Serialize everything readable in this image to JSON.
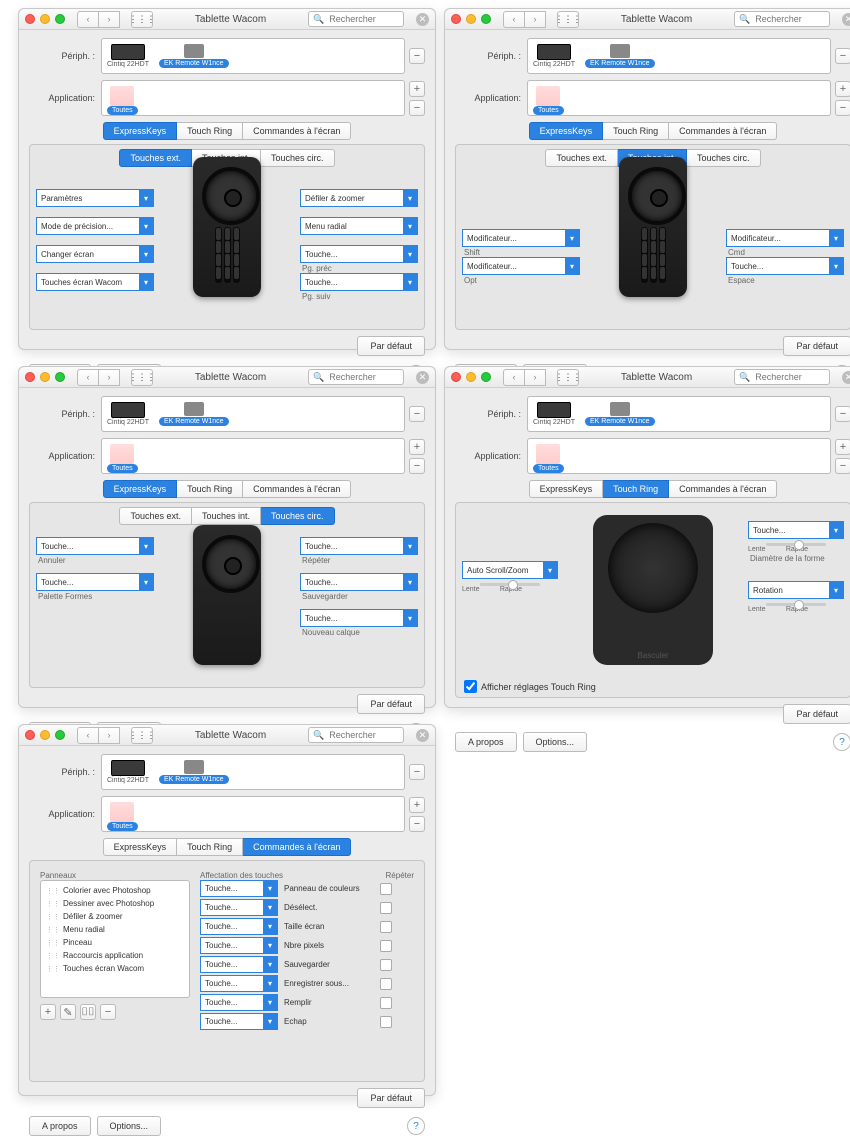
{
  "common": {
    "window_title": "Tablette Wacom",
    "search_placeholder": "Rechercher",
    "periph_label": "Périph. :",
    "app_label": "Application:",
    "device1": "Cintiq 22HDT",
    "device2": "EK Remote W1nce",
    "app_all": "Toutes",
    "tabs_main": {
      "express": "ExpressKeys",
      "ring": "Touch Ring",
      "screen": "Commandes à l'écran"
    },
    "tabs_sub": {
      "ext": "Touches ext.",
      "int": "Touches int.",
      "circ": "Touches circ."
    },
    "default_btn": "Par défaut",
    "about_btn": "A propos",
    "options_btn": "Options...",
    "add": "+",
    "remove": "−"
  },
  "p1": {
    "left": {
      "a": "Paramètres",
      "b": "Mode de précision...",
      "c": "Changer écran",
      "d": "Touches écran Wacom"
    },
    "right": {
      "a": "Défiler & zoomer",
      "b": "Menu radial",
      "c": "Touche...",
      "c_sub": "Pg. préc",
      "d": "Touche...",
      "d_sub": "Pg. suiv"
    }
  },
  "p2": {
    "left": {
      "a": "Modificateur...",
      "a_sub": "Shift",
      "b": "Modificateur...",
      "b_sub": "Opt"
    },
    "right": {
      "a": "Modificateur...",
      "a_sub": "Cmd",
      "b": "Touche...",
      "b_sub": "Espace"
    }
  },
  "p3": {
    "left": {
      "a": "Touche...",
      "a_sub": "Annuler",
      "b": "Touche...",
      "b_sub": "Palette Formes"
    },
    "right": {
      "a": "Touche...",
      "a_sub": "Répéter",
      "b": "Touche...",
      "b_sub": "Sauvegarder",
      "c": "Touche...",
      "c_sub": "Nouveau calque"
    }
  },
  "p4": {
    "left": "Auto Scroll/Zoom",
    "right_a": "Touche...",
    "right_a_sub": "Diamètre de la forme",
    "right_b": "Rotation",
    "slow": "Lente",
    "fast": "Rapide",
    "toggle": "Basculer",
    "show": "Afficher réglages Touch Ring"
  },
  "p5": {
    "panels_hdr": "Panneaux",
    "items": [
      "Colorier avec Photoshop",
      "Dessiner avec Photoshop",
      "Défiler & zoomer",
      "Menu radial",
      "Pinceau",
      "Raccourcis application",
      "Touches écran Wacom"
    ],
    "col_assign": "Affectation des touches",
    "col_repeat": "Répéter",
    "rows": [
      {
        "k": "Touche...",
        "l": "Panneau de couleurs"
      },
      {
        "k": "Touche...",
        "l": "Désélect."
      },
      {
        "k": "Touche...",
        "l": "Taille écran"
      },
      {
        "k": "Touche...",
        "l": "Nbre pixels"
      },
      {
        "k": "Touche...",
        "l": "Sauvegarder"
      },
      {
        "k": "Touche...",
        "l": "Enregistrer sous..."
      },
      {
        "k": "Touche...",
        "l": "Remplir"
      },
      {
        "k": "Touche...",
        "l": "Echap"
      }
    ],
    "toolbar": {
      "add": "+",
      "edit": "✎",
      "dup": "⌷⌷",
      "del": "−"
    }
  }
}
